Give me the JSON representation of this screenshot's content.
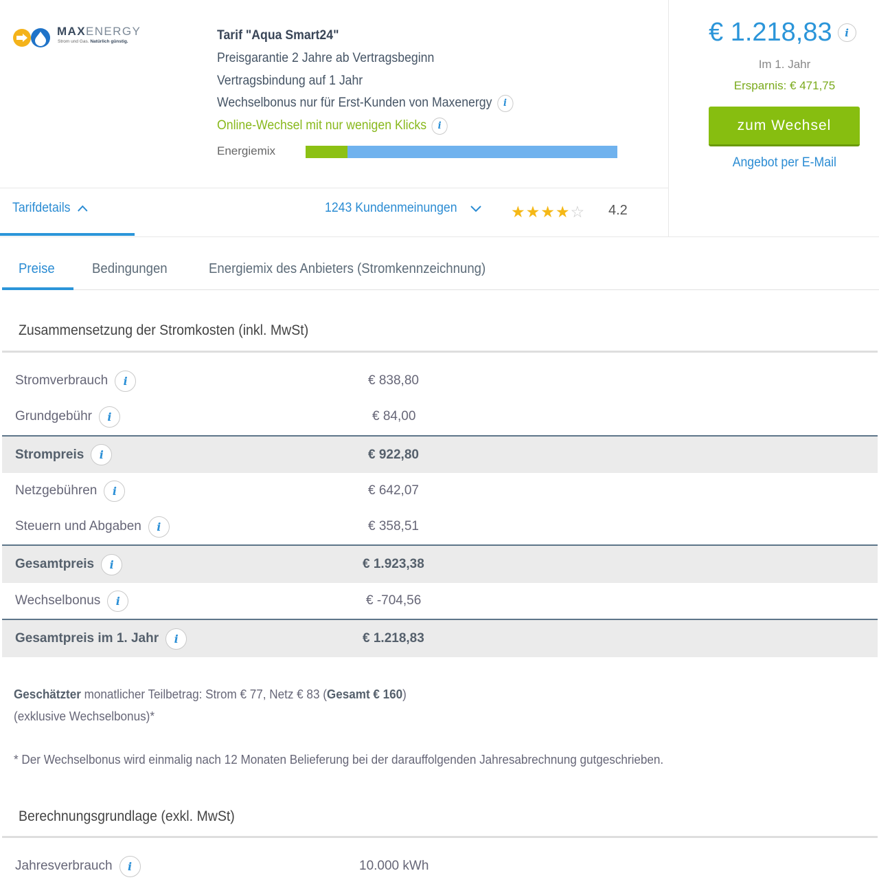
{
  "provider": {
    "logo": {
      "name_bold": "MAX",
      "name_light": "ENERGY",
      "tagline_prefix": "Strom und Gas.",
      "tagline_bold": "Natürlich günstig."
    }
  },
  "tarif": {
    "title": "Tarif \"Aqua Smart24\"",
    "line1": "Preisgarantie 2 Jahre ab Vertragsbeginn",
    "line2": "Vertragsbindung auf 1 Jahr",
    "line3": "Wechselbonus nur für Erst-Kunden von Maxenergy",
    "line4": "Online-Wechsel mit nur wenigen Klicks",
    "energiemix_label": "Energiemix",
    "energiemix_green_share": 0.135
  },
  "summary": {
    "price": "€ 1.218,83",
    "period": "Im 1. Jahr",
    "savings": "Ersparnis: € 471,75",
    "cta": "zum Wechsel",
    "email_link": "Angebot per E-Mail"
  },
  "details_bar": {
    "tarifdetails": "Tarifdetails",
    "reviews": "1243 Kundenmeinungen",
    "rating": "4.2",
    "stars_filled": 4
  },
  "tabs": [
    "Preise",
    "Bedingungen",
    "Energiemix des Anbieters (Stromkennzeichnung)"
  ],
  "cost_section": {
    "title": "Zusammensetzung der Stromkosten (inkl. MwSt)",
    "rows": [
      {
        "label": "Stromverbrauch",
        "value": "€ 838,80",
        "total": false
      },
      {
        "label": "Grundgebühr",
        "value": "€ 84,00",
        "total": false
      },
      {
        "label": "Strompreis",
        "value": "€ 922,80",
        "total": true
      },
      {
        "label": "Netzgebühren",
        "value": "€ 642,07",
        "total": false
      },
      {
        "label": "Steuern und Abgaben",
        "value": "€ 358,51",
        "total": false
      },
      {
        "label": "Gesamtpreis",
        "value": "€ 1.923,38",
        "total": true
      },
      {
        "label": "Wechselbonus",
        "value": "€ -704,56",
        "total": false
      },
      {
        "label": "Gesamtpreis im 1. Jahr",
        "value": "€ 1.218,83",
        "total": true
      }
    ]
  },
  "monthly": {
    "bold1": "Geschätzter",
    "text1": " monatlicher Teilbetrag: Strom € 77, Netz € 83 (",
    "bold2": "Gesamt € 160",
    "text2": ")",
    "line2": "(exklusive Wechselbonus)*",
    "footnote": "* Der Wechselbonus wird einmalig nach 12 Monaten Belieferung bei der darauffolgenden Jahresabrechnung gutgeschrieben."
  },
  "basis_section": {
    "title": "Berechnungsgrundlage (exkl. MwSt)",
    "rows": [
      {
        "label": "Jahresverbrauch",
        "value": "10.000 kWh"
      }
    ]
  },
  "colors": {
    "accent": "#2b95d9",
    "green": "#87be10",
    "total_row": "#ebebeb"
  },
  "icons": {
    "info": "info-icon",
    "chevron_up": "chevron-up-icon",
    "chevron_down": "chevron-down-icon",
    "star": "star-icon"
  }
}
